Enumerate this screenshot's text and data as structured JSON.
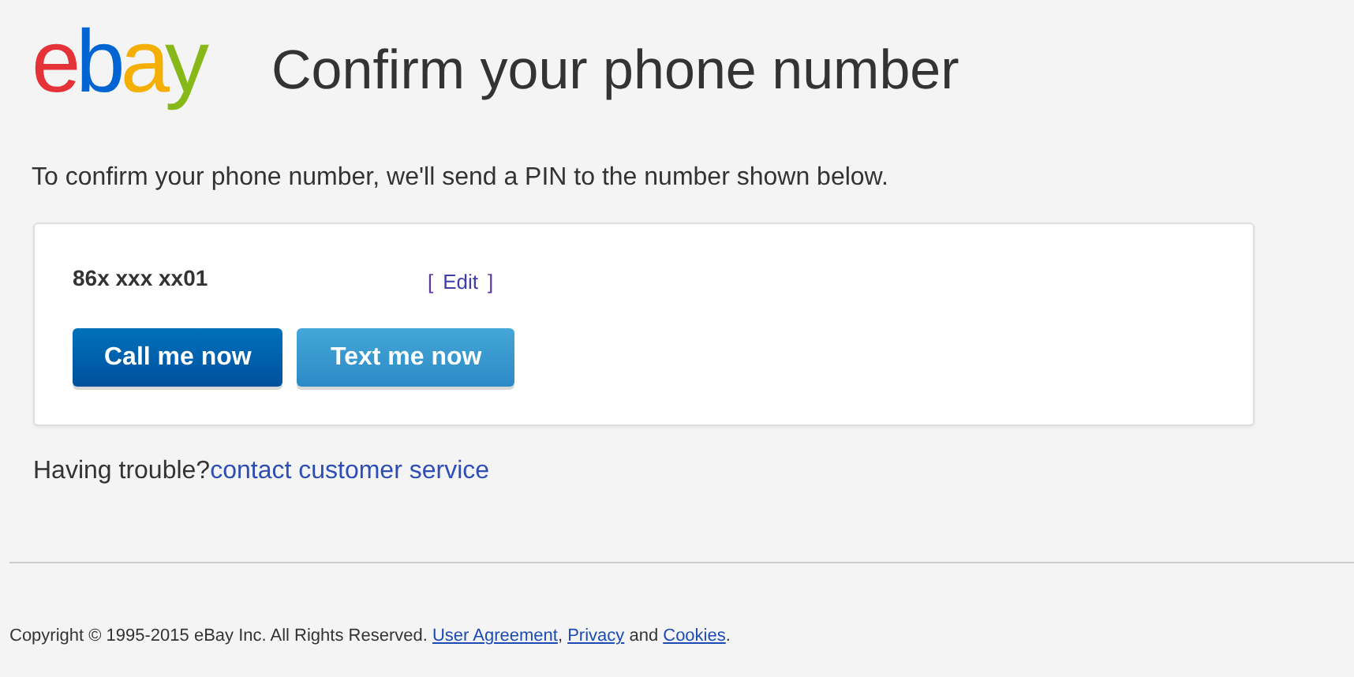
{
  "logo": {
    "letters": [
      {
        "text": "e",
        "color": "#e53238"
      },
      {
        "text": "b",
        "color": "#0064d2"
      },
      {
        "text": "a",
        "color": "#f5af02"
      },
      {
        "text": "y",
        "color": "#86b817"
      }
    ]
  },
  "title": "Confirm your phone number",
  "intro": "To confirm your phone number, we'll send a PIN to the number shown below.",
  "card": {
    "phone": "86x xxx xx01",
    "edit": {
      "open": "[",
      "label": "Edit",
      "close": "]"
    },
    "buttons": [
      {
        "label": "Call me now",
        "kind": "primary"
      },
      {
        "label": "Text me now",
        "kind": "secondary"
      }
    ]
  },
  "help": [
    {
      "kind": "text",
      "text": "Having trouble?"
    },
    {
      "kind": "link",
      "text": "contact customer service"
    }
  ],
  "footer": [
    {
      "kind": "text",
      "text": "Copyright © 1995-2015 eBay Inc. All Rights Reserved. "
    },
    {
      "kind": "link",
      "text": "User Agreement"
    },
    {
      "kind": "text",
      "text": ", "
    },
    {
      "kind": "link",
      "text": "Privacy"
    },
    {
      "kind": "text",
      "text": " and "
    },
    {
      "kind": "link",
      "text": "Cookies"
    },
    {
      "kind": "text",
      "text": "."
    }
  ]
}
